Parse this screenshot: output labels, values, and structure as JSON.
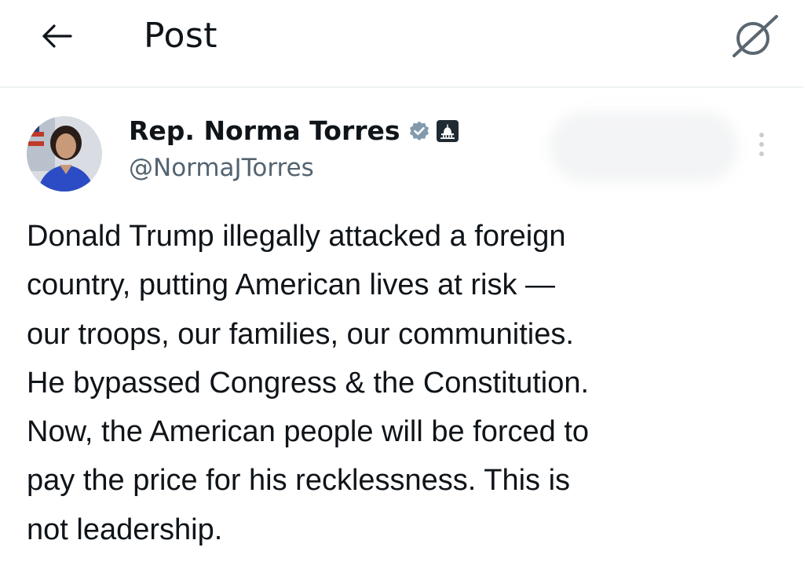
{
  "header": {
    "title": "Post"
  },
  "post": {
    "author": {
      "display_name": "Rep. Norma Torres",
      "handle": "@NormaJTorres"
    },
    "text": "Donald Trump illegally attacked a foreign\ncountry,  putting American lives at risk —\nour troops, our families, our communities.\nHe bypassed Congress & the Constitution.\nNow, the American people will be forced to\npay the price for his recklessness. This is\nnot leadership."
  },
  "colors": {
    "verified_badge": "#829aab",
    "text_primary": "#0f1419",
    "text_secondary": "#536471",
    "divider": "#eff3f4"
  },
  "icons": {
    "back": "arrow-left-icon",
    "grok": "grok-icon",
    "verified": "verified-badge-icon",
    "gov": "government-affiliation-icon",
    "more": "more-vertical-icon"
  }
}
